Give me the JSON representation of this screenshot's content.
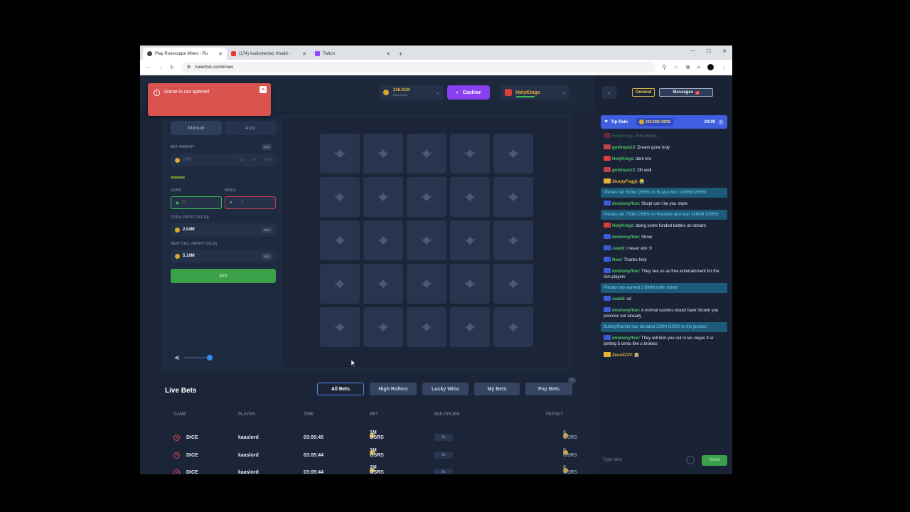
{
  "browser": {
    "tabs": [
      {
        "title": "Play Runescape Mines - Ru",
        "active": true
      },
      {
        "title": "(174) Audiomental, Khalid -",
        "active": false
      },
      {
        "title": "Twitch",
        "active": false
      }
    ],
    "url": "runechat.com/mines"
  },
  "toast": {
    "message": "Game is not opened"
  },
  "header": {
    "balance": {
      "amount": "216.01M",
      "currency": "RS3 GOLD"
    },
    "cashier_label": "Cashier",
    "username": "HolyKings"
  },
  "controls": {
    "modes": [
      "Manual",
      "Auto"
    ],
    "bet_amount_label": "BET AMOUNT",
    "bet_amount_value": "20M",
    "bet_tag": "RS3",
    "bet_multipliers": [
      "1/2",
      "2x",
      "Max"
    ],
    "gems_label": "GEMS",
    "gems_value": "22",
    "mines_label": "MINES",
    "mines_value": "3",
    "total_profit_label": "TOTAL PROFIT (X1.10)",
    "total_profit_value": "2.04M",
    "next_profit_label": "NEXT CELL PROFIT (X0.26)",
    "next_profit_value": "5.19M",
    "bet_button": "Bet"
  },
  "board": {
    "rows": 5,
    "cols": 5
  },
  "live_bets": {
    "title": "Live Bets",
    "filters": [
      "All Bets",
      "High Rollers",
      "Lucky Wins",
      "My Bets",
      "Pvp Bets"
    ],
    "pvp_count": "1",
    "columns": [
      "GAME",
      "PLAYER",
      "TIME",
      "BET",
      "MULTIPLIER",
      "PAYOUT"
    ],
    "rows": [
      {
        "game": "DICE",
        "player": "kaaslord",
        "time": "03:05:45",
        "bet": "1M OSRS",
        "multiplier": "0x",
        "payout": "0 OSRS"
      },
      {
        "game": "DICE",
        "player": "kaaslord",
        "time": "03:05:44",
        "bet": "1M OSRS",
        "multiplier": "0x",
        "payout": "0 OSRS"
      },
      {
        "game": "DICE",
        "player": "kaaslord",
        "time": "03:05:44",
        "bet": "1M OSRS",
        "multiplier": "0x",
        "payout": "0 OSRS"
      }
    ]
  },
  "chat": {
    "channels": {
      "general": "General",
      "messages": "Messages",
      "unread": "8"
    },
    "tip_rain": {
      "label": "Tip Rain",
      "pot": "219.33M OSRS",
      "timer": "24:09"
    },
    "messages": [
      {
        "user": "HolyKings",
        "text": "Kick Holyst...",
        "kind": "fade"
      },
      {
        "user": "goldreps13",
        "text": "Dream gone holy"
      },
      {
        "user": "HolyKings",
        "text": "dam bro"
      },
      {
        "user": "goldreps13",
        "text": "Oh well"
      },
      {
        "user": "SlurpyFoggi",
        "text": "😭",
        "gold": true
      },
      {
        "text": "Pikolas bet 500M OSRS on Bj and won 1000M OSRS!",
        "kind": "sys"
      },
      {
        "user": "dowlsmyflow",
        "text": "Slurpl can i be you slqve"
      },
      {
        "text": "Pikolas bet 730M OSRS on Roulette and won 1460M OSRS!",
        "kind": "sys"
      },
      {
        "user": "HolyKings",
        "text": "doing some funded battles on stream"
      },
      {
        "user": "dowlsmyflow",
        "text": "Show"
      },
      {
        "user": "swatd",
        "text": "i never win :9"
      },
      {
        "user": "Nani",
        "text": "Thanks holy"
      },
      {
        "user": "dowlsmyflow",
        "text": "They see us as free entertainment for the rich players"
      },
      {
        "text": "Pikolas has earned 1 BMW raffle ticket!",
        "kind": "sys"
      },
      {
        "user": "swatd",
        "text": "xd"
      },
      {
        "user": "dowlsmyflow",
        "text": "A normal casinos would have thrown you poorons out already"
      },
      {
        "text": "BubblyRumblr has donated 200M OSRS to the jackpot",
        "kind": "sys"
      },
      {
        "user": "dowlsmyflow",
        "text": "They will kick you out in las vegas if ur betting 5 cents like u brokies"
      },
      {
        "user": "ZeusXCIV",
        "text": "🎰",
        "gold": true
      }
    ],
    "input_placeholder": "Type here",
    "send_label": "Send"
  }
}
